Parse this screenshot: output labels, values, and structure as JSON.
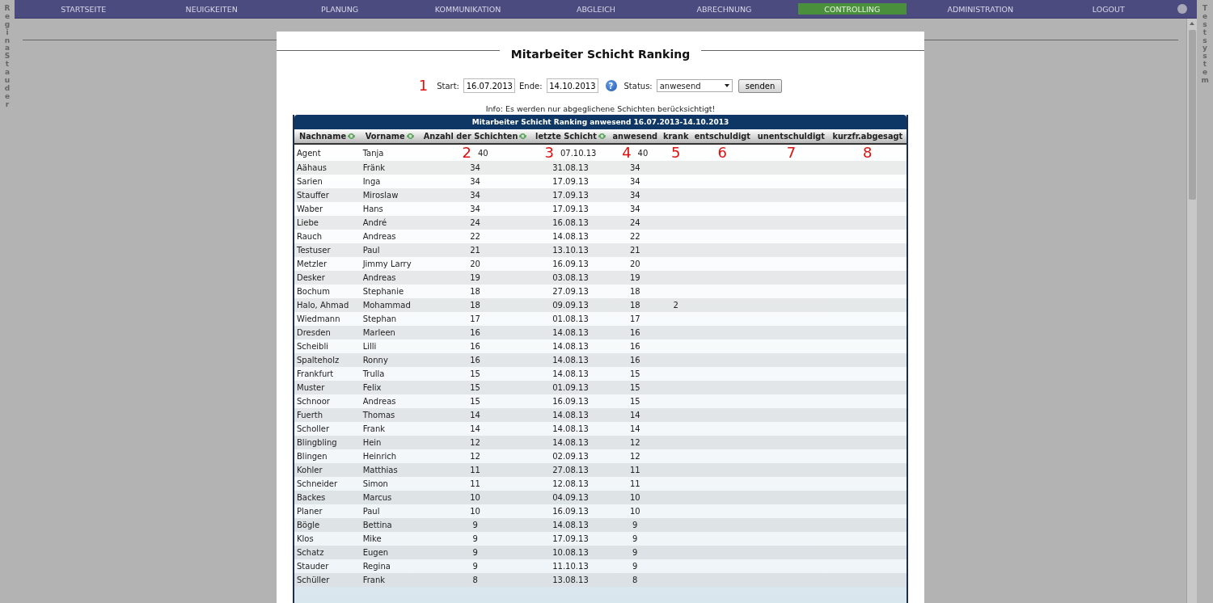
{
  "nav": {
    "items": [
      {
        "label": "STARTSEITE",
        "selected": false
      },
      {
        "label": "NEUIGKEITEN",
        "selected": false
      },
      {
        "label": "PLANUNG",
        "selected": false
      },
      {
        "label": "KOMMUNIKATION",
        "selected": false
      },
      {
        "label": "ABGLEICH",
        "selected": false
      },
      {
        "label": "ABRECHNUNG",
        "selected": false
      },
      {
        "label": "CONTROLLING",
        "selected": true
      },
      {
        "label": "ADMINISTRATION",
        "selected": false
      },
      {
        "label": "LOGOUT",
        "selected": false
      }
    ]
  },
  "left_sidebar": {
    "text": "Regina Stauder"
  },
  "right_sidebar": {
    "text": "Testsystem"
  },
  "title": "Mitarbeiter Schicht Ranking",
  "filter": {
    "marker": "1",
    "start_label": "Start:",
    "start": "16.07.2013",
    "end_label": "Ende:",
    "end": "14.10.2013",
    "help": "?",
    "status_label": "Status:",
    "status": "anwesend",
    "submit": "senden"
  },
  "info": "Info: Es werden nur abgeglichene Schichten berücksichtigt!",
  "table": {
    "caption": "Mitarbeiter Schicht Ranking anwesend 16.07.2013-14.10.2013",
    "columns": [
      {
        "label": "Nachname",
        "sortable": true
      },
      {
        "label": "Vorname",
        "sortable": true
      },
      {
        "label": "Anzahl der Schichten",
        "sortable": true,
        "marker": "2"
      },
      {
        "label": "letzte Schicht",
        "sortable": true,
        "marker": "3"
      },
      {
        "label": "anwesend",
        "sortable": false,
        "marker": "4"
      },
      {
        "label": "krank",
        "sortable": false,
        "marker": "5"
      },
      {
        "label": "entschuldigt",
        "sortable": false,
        "marker": "6"
      },
      {
        "label": "unentschuldigt",
        "sortable": false,
        "marker": "7"
      },
      {
        "label": "kurzfr.abgesagt",
        "sortable": false,
        "marker": "8"
      }
    ],
    "rows": [
      [
        "Agent",
        "Tanja",
        "40",
        "07.10.13",
        "40"
      ],
      [
        "Aähaus",
        "Fränk",
        "34",
        "31.08.13",
        "34"
      ],
      [
        "Sarien",
        "Inga",
        "34",
        "17.09.13",
        "34"
      ],
      [
        "Stauffer",
        "Miroslaw",
        "34",
        "17.09.13",
        "34"
      ],
      [
        "Waber",
        "Hans",
        "34",
        "17.09.13",
        "34"
      ],
      [
        "Liebe",
        "André",
        "24",
        "16.08.13",
        "24"
      ],
      [
        "Rauch",
        "Andreas",
        "22",
        "14.08.13",
        "22"
      ],
      [
        "Testuser",
        "Paul",
        "21",
        "13.10.13",
        "21"
      ],
      [
        "Metzler",
        "Jimmy Larry",
        "20",
        "16.09.13",
        "20"
      ],
      [
        "Desker",
        "Andreas",
        "19",
        "03.08.13",
        "19"
      ],
      [
        "Bochum",
        "Stephanie",
        "18",
        "27.09.13",
        "18"
      ],
      [
        "Halo, Ahmad",
        "Mohammad",
        "18",
        "09.09.13",
        "18",
        "2"
      ],
      [
        "Wiedmann",
        "Stephan",
        "17",
        "01.08.13",
        "17"
      ],
      [
        "Dresden",
        "Marleen",
        "16",
        "14.08.13",
        "16"
      ],
      [
        "Scheibli",
        "Lilli",
        "16",
        "14.08.13",
        "16"
      ],
      [
        "Spalteholz",
        "Ronny",
        "16",
        "14.08.13",
        "16"
      ],
      [
        "Frankfurt",
        "Trulla",
        "15",
        "14.08.13",
        "15"
      ],
      [
        "Muster",
        "Felix",
        "15",
        "01.09.13",
        "15"
      ],
      [
        "Schnoor",
        "Andreas",
        "15",
        "16.09.13",
        "15"
      ],
      [
        "Fuerth",
        "Thomas",
        "14",
        "14.08.13",
        "14"
      ],
      [
        "Scholler",
        "Frank",
        "14",
        "14.08.13",
        "14"
      ],
      [
        "Blingbling",
        "Hein",
        "12",
        "14.08.13",
        "12"
      ],
      [
        "Blingen",
        "Heinrich",
        "12",
        "02.09.13",
        "12"
      ],
      [
        "Kohler",
        "Matthias",
        "11",
        "27.08.13",
        "11"
      ],
      [
        "Schneider",
        "Simon",
        "11",
        "12.08.13",
        "11"
      ],
      [
        "Backes",
        "Marcus",
        "10",
        "04.09.13",
        "10"
      ],
      [
        "Planer",
        "Paul",
        "10",
        "16.09.13",
        "10"
      ],
      [
        "Bögle",
        "Bettina",
        "9",
        "14.08.13",
        "9"
      ],
      [
        "Klos",
        "Mike",
        "9",
        "17.09.13",
        "9"
      ],
      [
        "Schatz",
        "Eugen",
        "9",
        "10.08.13",
        "9"
      ],
      [
        "Stauder",
        "Regina",
        "9",
        "11.10.13",
        "9"
      ],
      [
        "Schüller",
        "Frank",
        "8",
        "13.08.13",
        "8"
      ]
    ]
  }
}
